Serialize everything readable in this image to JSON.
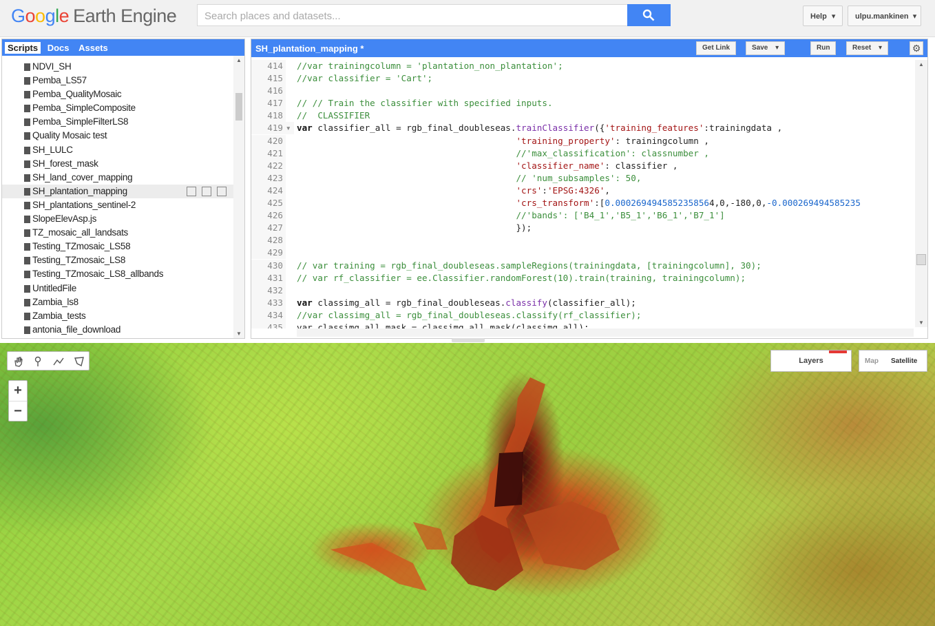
{
  "app": {
    "logo_google": [
      "G",
      "o",
      "o",
      "g",
      "l",
      "e"
    ],
    "logo_product": "Earth Engine"
  },
  "search": {
    "placeholder": "Search places and datasets..."
  },
  "header": {
    "help_label": "Help",
    "user_label": "ulpu.mankinen"
  },
  "left_panel": {
    "tabs": [
      "Scripts",
      "Docs",
      "Assets"
    ],
    "active_tab": "Scripts",
    "scripts": [
      "NDVI_SH",
      "Pemba_LS57",
      "Pemba_QualityMosaic",
      "Pemba_SimpleComposite",
      "Pemba_SimpleFilterLS8",
      "Quality Mosaic test",
      "SH_LULC",
      "SH_forest_mask",
      "SH_land_cover_mapping",
      "SH_plantation_mapping",
      "SH_plantations_sentinel-2",
      "SlopeElevAsp.js",
      "TZ_mosaic_all_landsats",
      "Testing_TZmosaic_LS58",
      "Testing_TZmosaic_LS8",
      "Testing_TZmosaic_LS8_allbands",
      "UntitledFile",
      "Zambia_ls8",
      "Zambia_tests",
      "antonia_file_download"
    ],
    "selected_script": "SH_plantation_mapping"
  },
  "editor": {
    "title": "SH_plantation_mapping *",
    "buttons": {
      "get_link": "Get Link",
      "save": "Save",
      "run": "Run",
      "reset": "Reset"
    },
    "line_numbers": [
      "414",
      "415",
      "416",
      "417",
      "418",
      "419",
      "420",
      "421",
      "422",
      "423",
      "424",
      "425",
      "426",
      "427",
      "428",
      "429",
      "430",
      "431",
      "432",
      "433",
      "434",
      "435"
    ],
    "lines": [
      [
        {
          "t": "//var trainingcolumn = 'plantation_non_plantation';",
          "c": "cm"
        }
      ],
      [
        {
          "t": "//var classifier = 'Cart';",
          "c": "cm"
        }
      ],
      [],
      [
        {
          "t": "// // Train the classifier with specified inputs.",
          "c": "cm"
        }
      ],
      [
        {
          "t": "//  CLASSIFIER",
          "c": "cm"
        }
      ],
      [
        {
          "t": "var",
          "c": "kw"
        },
        {
          "t": " classifier_all = rgb_final_doubleseas.",
          "c": ""
        },
        {
          "t": "trainClassifier",
          "c": "fn"
        },
        {
          "t": "({",
          "c": ""
        },
        {
          "t": "'training_features'",
          "c": "str"
        },
        {
          "t": ":trainingdata ,",
          "c": ""
        }
      ],
      [
        {
          "t": "                                          ",
          "c": ""
        },
        {
          "t": "'training_property'",
          "c": "str"
        },
        {
          "t": ": trainingcolumn ,",
          "c": ""
        }
      ],
      [
        {
          "t": "                                          ",
          "c": ""
        },
        {
          "t": "//'max_classification': classnumber ,",
          "c": "cm"
        }
      ],
      [
        {
          "t": "                                          ",
          "c": ""
        },
        {
          "t": "'classifier_name'",
          "c": "str"
        },
        {
          "t": ": classifier ,",
          "c": ""
        }
      ],
      [
        {
          "t": "                                          ",
          "c": ""
        },
        {
          "t": "// 'num_subsamples': 50,",
          "c": "cm"
        }
      ],
      [
        {
          "t": "                                          ",
          "c": ""
        },
        {
          "t": "'crs'",
          "c": "str"
        },
        {
          "t": ":",
          "c": ""
        },
        {
          "t": "'EPSG:4326'",
          "c": "str"
        },
        {
          "t": ",",
          "c": ""
        }
      ],
      [
        {
          "t": "                                          ",
          "c": ""
        },
        {
          "t": "'crs_transform'",
          "c": "str"
        },
        {
          "t": ":[",
          "c": ""
        },
        {
          "t": "0.000269494585235856",
          "c": "num"
        },
        {
          "t": "4,0,-180,0,",
          "c": ""
        },
        {
          "t": "-0.000269494585235",
          "c": "num"
        }
      ],
      [
        {
          "t": "                                          ",
          "c": ""
        },
        {
          "t": "//'bands': ['B4_1','B5_1','B6_1','B7_1']",
          "c": "cm"
        }
      ],
      [
        {
          "t": "                                          });",
          "c": ""
        }
      ],
      [],
      [],
      [
        {
          "t": "// var training = rgb_final_doubleseas.sampleRegions(trainingdata, [trainingcolumn], 30);",
          "c": "cm"
        }
      ],
      [
        {
          "t": "// var rf_classifier = ee.Classifier.randomForest(10).train(training, trainingcolumn);",
          "c": "cm"
        }
      ],
      [],
      [
        {
          "t": "var",
          "c": "kw"
        },
        {
          "t": " classimg_all = rgb_final_doubleseas.",
          "c": ""
        },
        {
          "t": "classify",
          "c": "fn"
        },
        {
          "t": "(classifier_all);",
          "c": ""
        }
      ],
      [
        {
          "t": "//var classimg_all = rgb_final_doubleseas.classify(rf_classifier);",
          "c": "cm"
        }
      ],
      [
        {
          "t": "var classimg_all_mask = classimg_all.mask(classimg_all);",
          "c": ""
        }
      ]
    ]
  },
  "map": {
    "zoom_in": "+",
    "zoom_out": "−",
    "layers_label": "Layers",
    "map_type_options": [
      "Map",
      "Satellite"
    ]
  },
  "colors": {
    "brand_blue": "#4285f4",
    "layers_accent": "#e53935"
  },
  "icons": {
    "search": "search-icon",
    "file": "file-icon",
    "gear": "gear-icon",
    "pan": "hand-icon",
    "marker": "marker-icon",
    "line": "line-icon",
    "polygon": "polygon-icon"
  }
}
